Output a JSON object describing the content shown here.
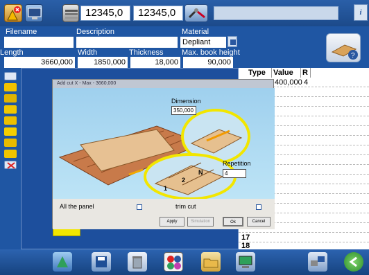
{
  "toolbar": {
    "field1": "12345,0",
    "field2": "12345,0",
    "info_label": "i"
  },
  "form": {
    "filename_label": "Filename",
    "description_label": "Description",
    "material_label": "Material",
    "material_value": "Depliant",
    "length_label": "Length",
    "length_value": "3660,000",
    "width_label": "Width",
    "width_value": "1850,000",
    "thickness_label": "Thickness",
    "thickness_value": "18,000",
    "maxbook_label": "Max. book height",
    "maxbook_value": "90,000"
  },
  "table": {
    "headers": [
      "Type",
      "Value",
      "R"
    ],
    "rows": [
      {
        "type": "",
        "value": "400,000",
        "r": "4"
      }
    ],
    "row_numbers": [
      "17",
      "18"
    ]
  },
  "dialog": {
    "title": "Add cut X - Max - 3660,000",
    "dimension_label": "Dimension",
    "dimension_value": "350,000",
    "repetition_label": "Repetition",
    "repetition_value": "4",
    "all_panel_label": "All the panel",
    "trim_cut_label": "trim cut",
    "apply": "Apply",
    "disabled_btn": "Simulation",
    "ok": "Ok",
    "cancel": "Cancel",
    "board_labels": [
      "1",
      "2",
      "N"
    ]
  },
  "colors": {
    "accent_yellow": "#f2e600",
    "brand_blue": "#1f56a3"
  }
}
